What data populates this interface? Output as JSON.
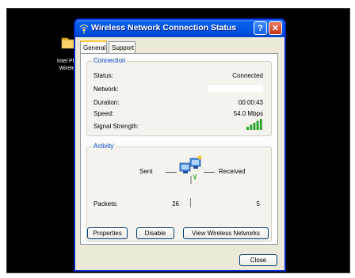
{
  "desktop": {
    "icon_label_line1": "Intel PRO/",
    "icon_label_line2": "Wireless"
  },
  "window": {
    "title": "Wireless Network Connection Status",
    "title_icon": "wireless-signal-icon",
    "help_button": "?",
    "close_button": "✕"
  },
  "tabs": [
    {
      "label": "General",
      "active": true
    },
    {
      "label": "Support",
      "active": false
    }
  ],
  "connection": {
    "group_title": "Connection",
    "status_label": "Status:",
    "status_value": "Connected",
    "network_label": "Network:",
    "duration_label": "Duration:",
    "duration_value": "00:00:43",
    "speed_label": "Speed:",
    "speed_value": "54.0 Mbps",
    "signal_label": "Signal Strength:",
    "signal_bars": 5,
    "signal_color": "#2FA52F"
  },
  "activity": {
    "group_title": "Activity",
    "sent_label": "Sent",
    "received_label": "Received",
    "packets_label": "Packets:",
    "packets_sent": "26",
    "packets_received": "5"
  },
  "buttons": {
    "properties": "Properties",
    "disable": "Disable",
    "view_networks": "View Wireless Networks",
    "close": "Close"
  }
}
